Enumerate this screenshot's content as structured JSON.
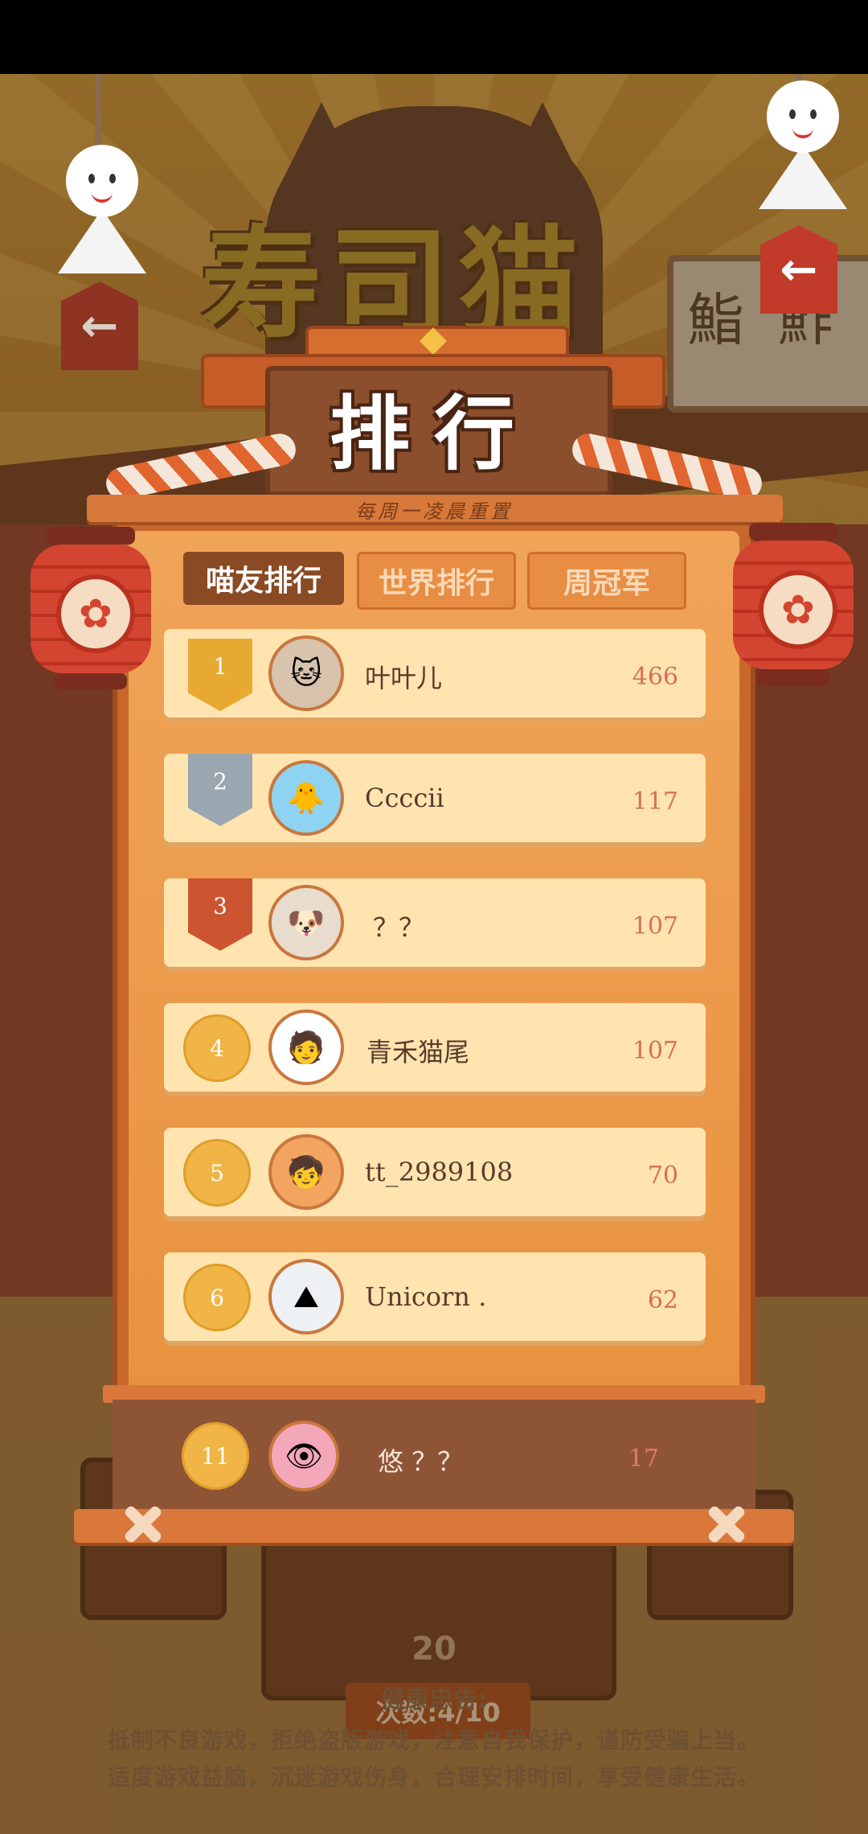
{
  "background": {
    "logo_text": "寿司猫",
    "sign_text": "鮨 鮓",
    "challenge_label": "",
    "challenge_count": "20",
    "tries_label": "次数:4/10",
    "health_title": "健康忠告:",
    "health_line_1": "抵制不良游戏，拒绝盗版游戏，注意自我保护，谨防受骗上当。",
    "health_line_2": "适度游戏益脑，沉迷游戏伤身，合理安排时间，享受健康生活。"
  },
  "panel": {
    "title": "排行",
    "subtitle": "每周一凌晨重置",
    "tabs": [
      {
        "label": "喵友排行",
        "active": true
      },
      {
        "label": "世界排行",
        "active": false
      },
      {
        "label": "周冠军",
        "active": false
      }
    ],
    "rows": [
      {
        "rank": "1",
        "name": "叶叶儿",
        "score": "466",
        "medal": "gold"
      },
      {
        "rank": "2",
        "name": "Ccccii",
        "score": "117",
        "medal": "silver"
      },
      {
        "rank": "3",
        "name": "？？",
        "score": "107",
        "medal": "bronze"
      },
      {
        "rank": "4",
        "name": "青禾猫尾",
        "score": "107",
        "medal": "coin"
      },
      {
        "rank": "5",
        "name": "tt_2989108",
        "score": "70",
        "medal": "coin"
      },
      {
        "rank": "6",
        "name": "Unicorn .",
        "score": "62",
        "medal": "coin"
      }
    ],
    "self": {
      "rank": "11",
      "name": "悠 ？？",
      "score": "17"
    }
  },
  "icons": {
    "back": "arrow-left-icon",
    "lantern_emblem": "flower-icon"
  },
  "colors": {
    "panel_wood": "#c8672b",
    "row_bg": "#ffe4b0",
    "score_text": "#d86d5a",
    "tab_active": "#8a4a24"
  }
}
